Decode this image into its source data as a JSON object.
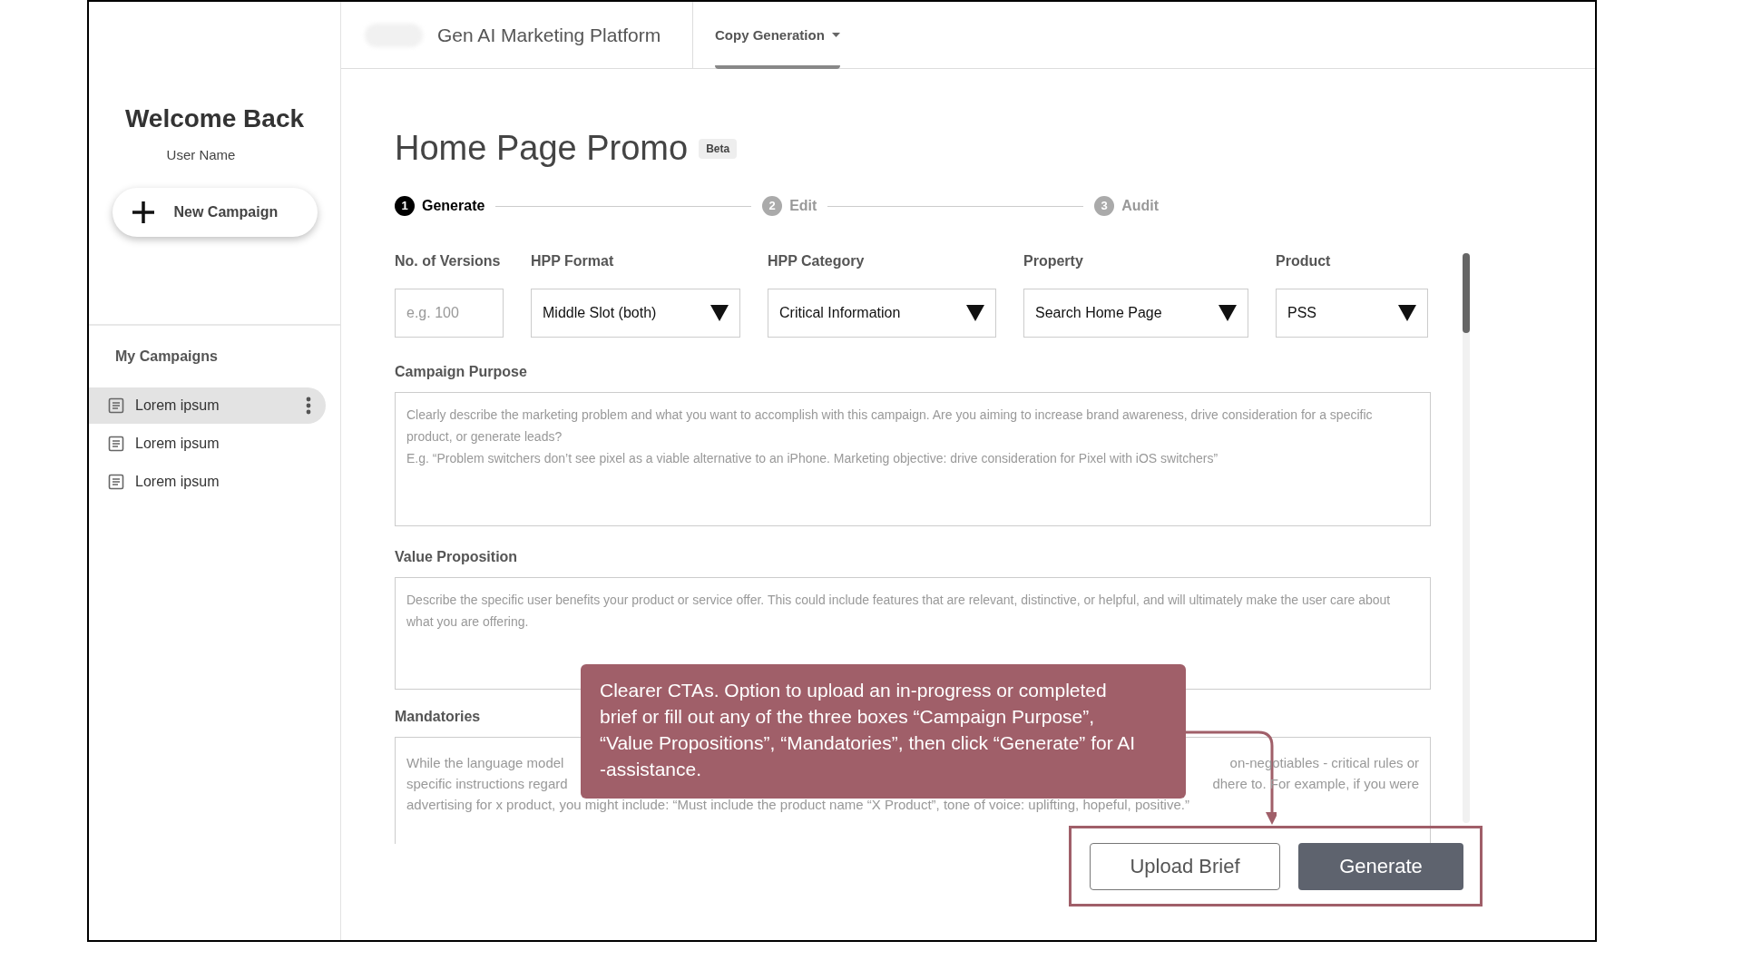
{
  "header": {
    "app_title": "Gen AI Marketing Platform",
    "tabs": [
      {
        "label": "Copy Generation",
        "selected": true
      }
    ]
  },
  "sidebar": {
    "greeting": "Welcome Back",
    "user_name": "User Name",
    "new_button": "New Campaign",
    "section_title": "My Campaigns",
    "campaigns": [
      {
        "label": "Lorem ipsum",
        "selected": true
      },
      {
        "label": "Lorem ipsum",
        "selected": false
      },
      {
        "label": "Lorem ipsum",
        "selected": false
      }
    ]
  },
  "page": {
    "title": "Home Page Promo",
    "badge": "Beta",
    "steps": [
      {
        "number": "1",
        "label": "Generate",
        "selected": true
      },
      {
        "number": "2",
        "label": "Edit",
        "selected": false
      },
      {
        "number": "3",
        "label": "Audit",
        "selected": false
      }
    ]
  },
  "fields": [
    {
      "kind": "input",
      "label": "No. of Versions",
      "placeholder": "e.g. 100"
    },
    {
      "kind": "select",
      "label": "HPP Format",
      "value": "Middle Slot (both)"
    },
    {
      "kind": "select",
      "label": "HPP Category",
      "value": "Critical Information"
    },
    {
      "kind": "select",
      "label": "Property",
      "value": "Search Home Page"
    },
    {
      "kind": "select",
      "label": "Product",
      "value": "PSS"
    }
  ],
  "text_areas": [
    {
      "label": "Campaign Purpose",
      "placeholder": "Clearly describe the marketing problem and what you want to accomplish with this campaign. Are you aiming to increase brand awareness, drive consideration for a specific product, or generate leads?\nE.g. “Problem switchers don’t see pixel as a viable alternative to an iPhone. Marketing objective: drive consideration for Pixel with iOS switchers”"
    },
    {
      "label": "Value Proposition",
      "placeholder": "Describe the specific user benefits your product or service offer. This could include features that are relevant, distinctive, or helpful, and will ultimately make the user care about what you are offering."
    }
  ],
  "mandatories": {
    "label": "Mandatories",
    "lines": [
      [
        "While the language model",
        "on-negotiables - critical rules or"
      ],
      [
        "specific instructions regard",
        "dhere to. For example, if you were"
      ],
      [
        "advertising for x product, you might include: “Must include the product name “X Product”, tone of voice: uplifting, hopeful, positive.”"
      ]
    ]
  },
  "buttons": [
    {
      "kind": "outline",
      "label": "Upload Brief"
    },
    {
      "kind": "primary",
      "label": "Generate"
    }
  ],
  "annotation": {
    "text": "Clearer CTAs. Option to upload an in-progress or completed brief or fill out any of the three boxes “Campaign Purpose”, “Value Propositions”, “Mandatories”, then click “Generate” for AI -assistance."
  }
}
